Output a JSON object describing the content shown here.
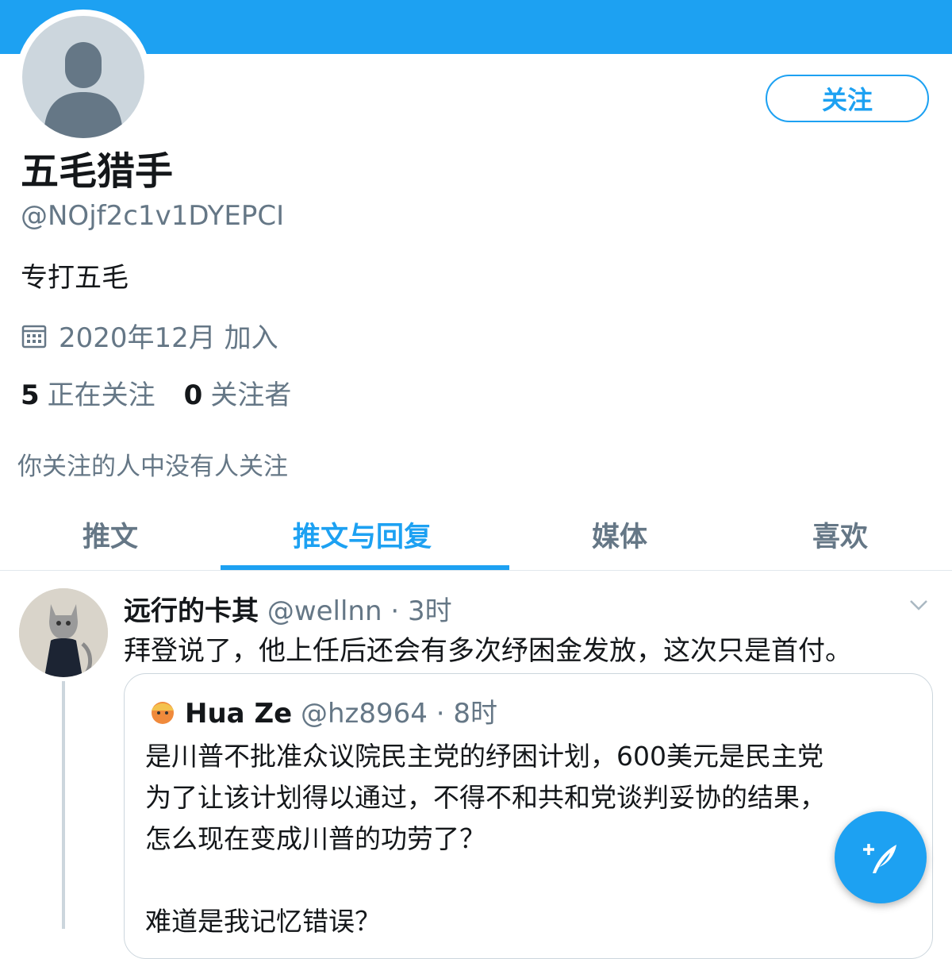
{
  "profile": {
    "name": "五毛猎手",
    "handle": "@NOjf2c1v1DYEPCI",
    "bio": "专打五毛",
    "joined": "2020年12月 加入",
    "following_count": "5",
    "following_label": "正在关注",
    "followers_count": "0",
    "followers_label": "关注者",
    "mutual_text": "你关注的人中没有人关注",
    "follow_button": "关注"
  },
  "tabs": [
    {
      "label": "推文"
    },
    {
      "label": "推文与回复"
    },
    {
      "label": "媒体"
    },
    {
      "label": "喜欢"
    }
  ],
  "active_tab": "推文与回复",
  "tweet": {
    "author": "远行的卡其",
    "handle": "@wellnn",
    "time": "· 3时",
    "text": "拜登说了，他上任后还会有多次纾困金发放，这次只是首付。",
    "quote": {
      "author": "Hua Ze",
      "handle": "@hz8964",
      "time": "· 8时",
      "lines": [
        "是川普不批准众议院民主党的纾困计划，600美元是民主党",
        "为了让该计划得以通过，不得不和共和党谈判妥协的结果，",
        "怎么现在变成川普的功劳了？",
        "",
        "难道是我记忆错误？"
      ]
    }
  },
  "colors": {
    "accent": "#1da1f2",
    "text_primary": "#14171a",
    "text_secondary": "#657786",
    "border": "#ccd6dd"
  },
  "icons": [
    "default-avatar-icon",
    "calendar-icon",
    "chevron-down-icon",
    "compose-tweet-icon"
  ]
}
